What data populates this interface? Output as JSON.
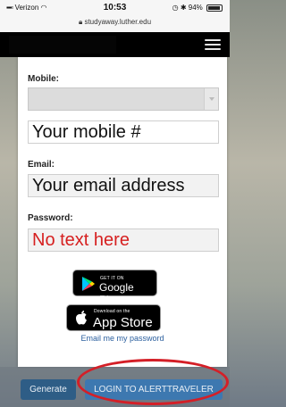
{
  "status_bar": {
    "carrier": "Verizon",
    "time": "10:53",
    "battery": "94%",
    "url": "studyaway.luther.edu"
  },
  "navbar": {
    "menu_icon": "hamburger-menu-icon"
  },
  "form": {
    "mobile_label": "Mobile:",
    "mobile_placeholder": "Your mobile #",
    "email_label": "Email:",
    "email_placeholder": "Your email address",
    "password_label": "Password:",
    "password_placeholder": "No text here"
  },
  "stores": {
    "google_play_small": "GET IT ON",
    "google_play_big": "Google Play",
    "app_store_small": "Download on the",
    "app_store_big": "App Store"
  },
  "email_password_link": "Email me my password",
  "buttons": {
    "generate": "Generate",
    "login": "LOGIN TO ALERTTRAVELER"
  },
  "colors": {
    "login_button": "#3d78b0",
    "generate_button": "#2e5d86",
    "annotation": "#d41f27",
    "placeholder_red": "#d62020"
  }
}
